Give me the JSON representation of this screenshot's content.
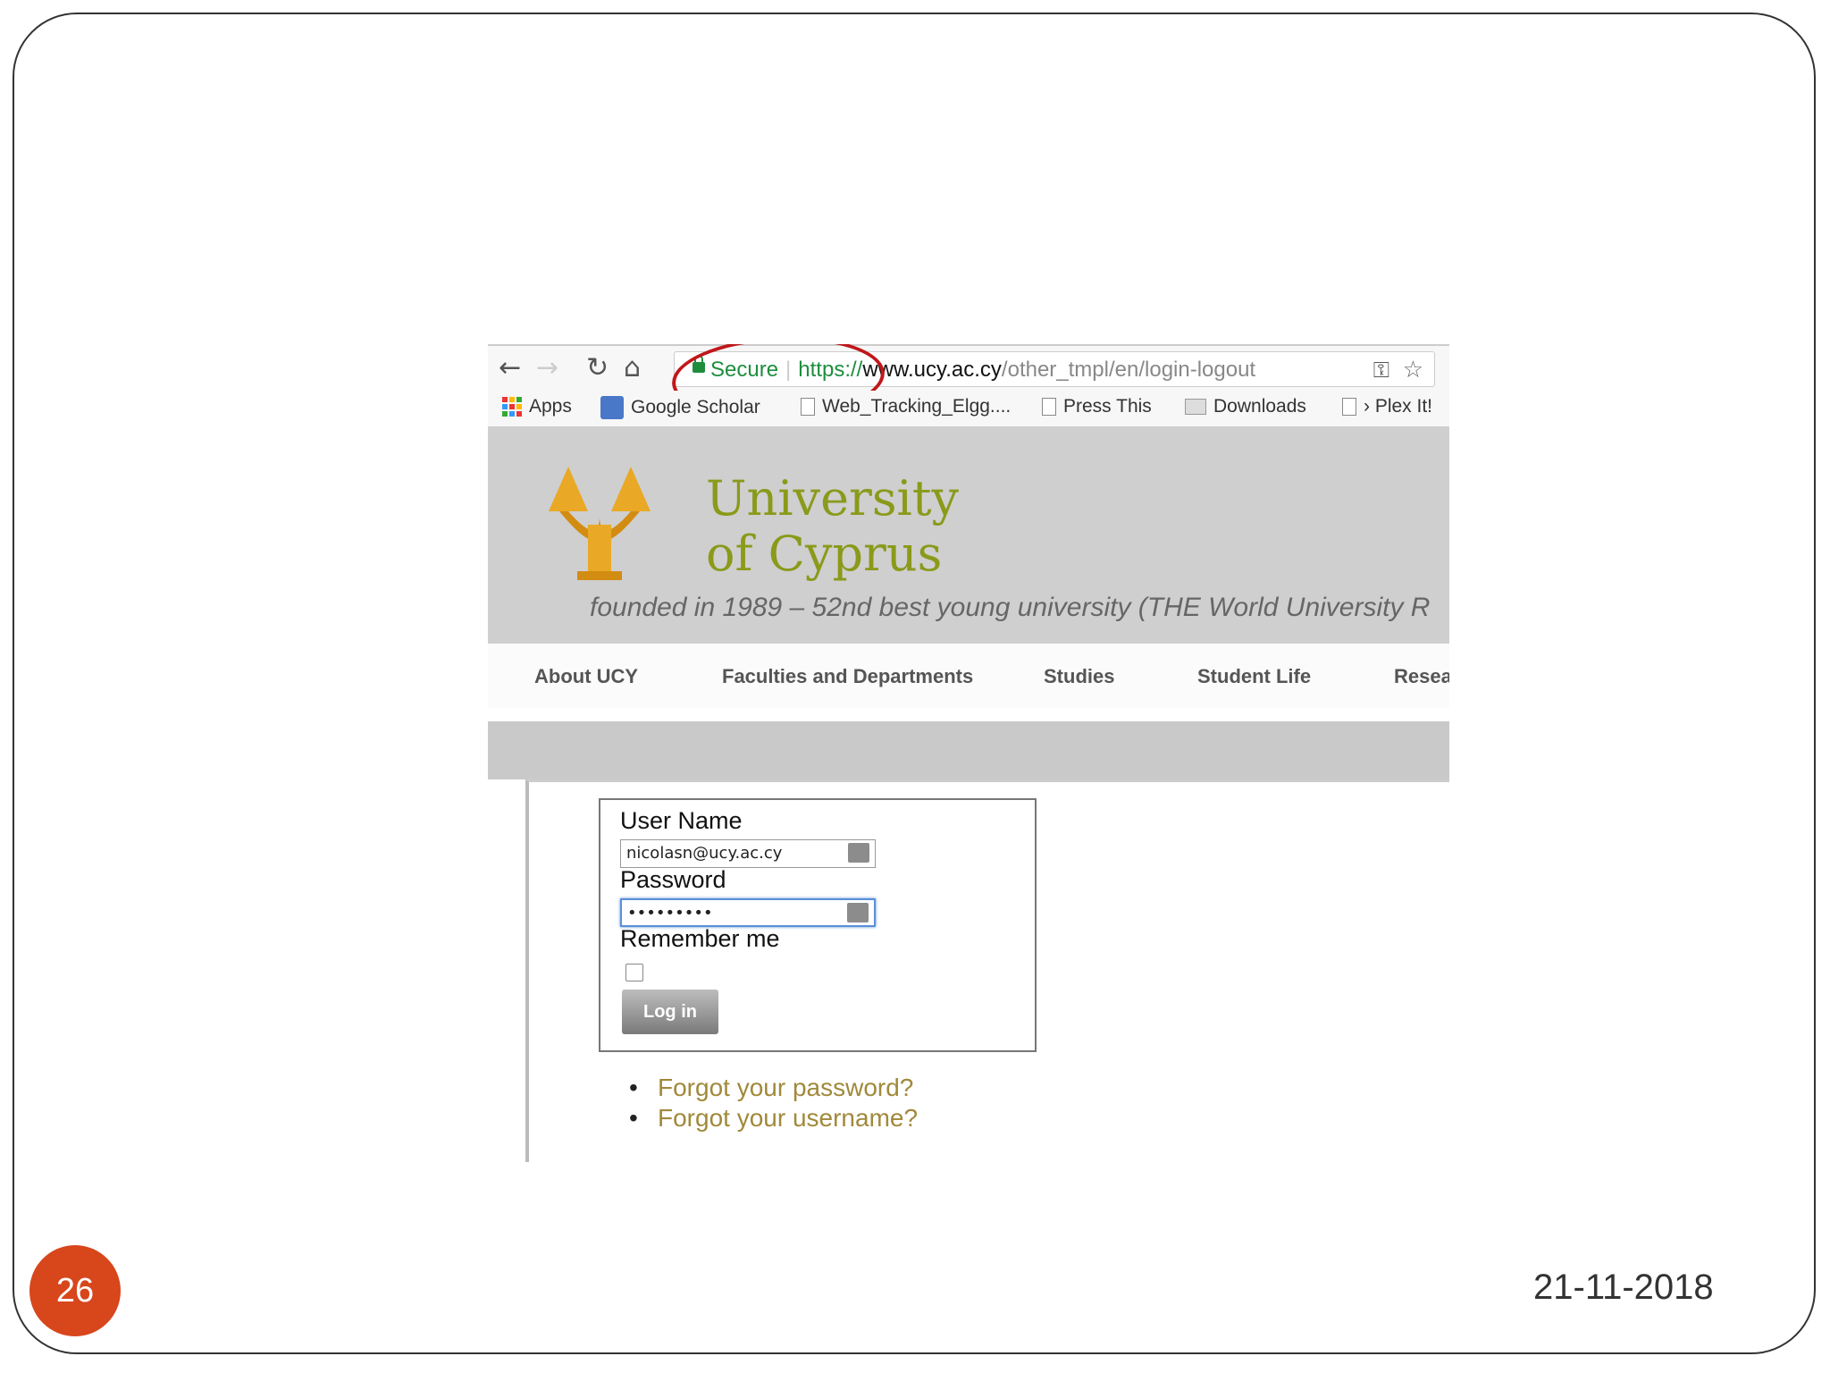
{
  "browser": {
    "address_bar": {
      "secure_label": "Secure",
      "scheme": "https://",
      "domain": "www.ucy.ac.cy",
      "path": "/other_tmpl/en/login-logout"
    },
    "bookmarks": [
      {
        "label": "Apps"
      },
      {
        "label": "Google Scholar"
      },
      {
        "label": "Web_Tracking_Elgg...."
      },
      {
        "label": "Press This"
      },
      {
        "label": "Downloads"
      },
      {
        "label": "› Plex It!"
      }
    ]
  },
  "site": {
    "name_line1": "University",
    "name_line2": "of Cyprus",
    "tagline": "founded in 1989 – 52nd best young university (THE World University R",
    "nav": [
      "About UCY",
      "Faculties and Departments",
      "Studies",
      "Student Life",
      "Resea"
    ]
  },
  "login": {
    "username_label": "User Name",
    "username_value": "nicolasn@ucy.ac.cy",
    "password_label": "Password",
    "password_value": "•••••••••",
    "remember_label": "Remember me",
    "login_button": "Log in",
    "forgot_password": "Forgot your password?",
    "forgot_username": "Forgot your username?"
  },
  "slide": {
    "number": "26",
    "date": "21-11-2018"
  },
  "colors": {
    "secure_green": "#1e8e3e",
    "annotation_red": "#c0171b",
    "slide_number_bg": "#d8461c",
    "link_color": "#a0893a"
  }
}
